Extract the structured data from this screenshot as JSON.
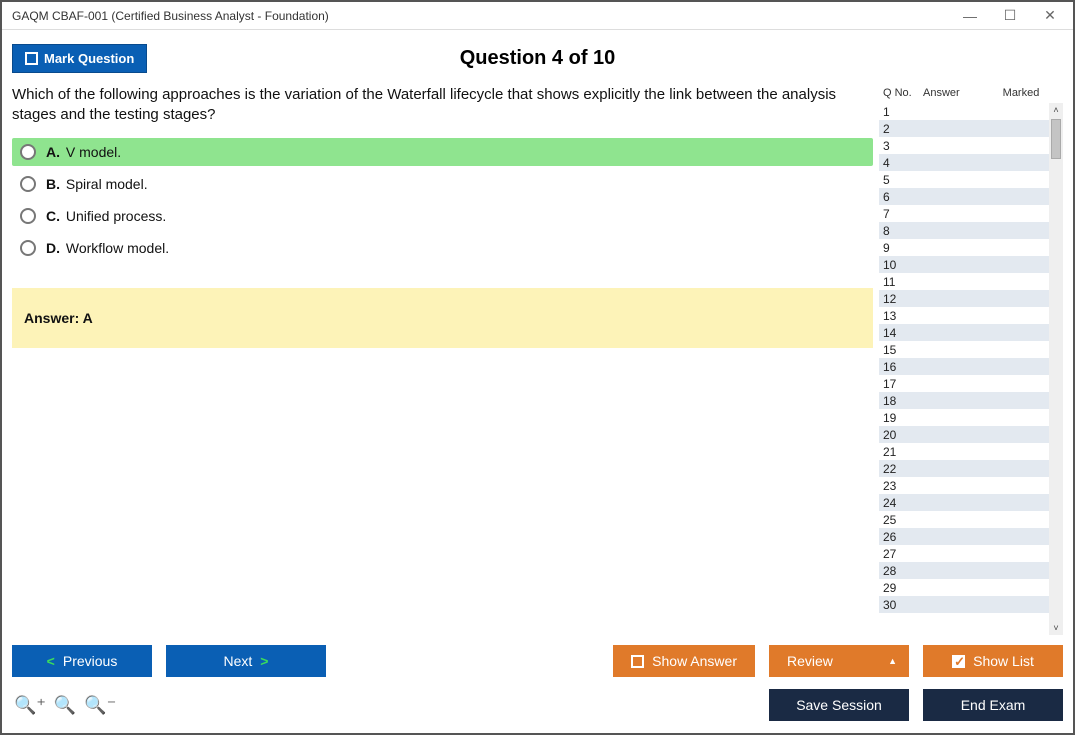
{
  "window": {
    "title": "GAQM CBAF-001 (Certified Business Analyst - Foundation)"
  },
  "header": {
    "mark_label": "Mark Question",
    "question_title": "Question 4 of 10"
  },
  "question": {
    "text": "Which of the following approaches is the variation of the Waterfall lifecycle that shows explicitly the link between the analysis stages and the testing stages?",
    "options": [
      {
        "letter": "A.",
        "text": "V model.",
        "correct": true
      },
      {
        "letter": "B.",
        "text": "Spiral model.",
        "correct": false
      },
      {
        "letter": "C.",
        "text": "Unified process.",
        "correct": false
      },
      {
        "letter": "D.",
        "text": "Workflow model.",
        "correct": false
      }
    ],
    "answer_label": "Answer: A"
  },
  "sidebar": {
    "headers": {
      "qno": "Q No.",
      "answer": "Answer",
      "marked": "Marked"
    },
    "rows": [
      1,
      2,
      3,
      4,
      5,
      6,
      7,
      8,
      9,
      10,
      11,
      12,
      13,
      14,
      15,
      16,
      17,
      18,
      19,
      20,
      21,
      22,
      23,
      24,
      25,
      26,
      27,
      28,
      29,
      30
    ]
  },
  "footer": {
    "previous": "Previous",
    "next": "Next",
    "show_answer": "Show Answer",
    "review": "Review",
    "show_list": "Show List",
    "save_session": "Save Session",
    "end_exam": "End Exam"
  }
}
